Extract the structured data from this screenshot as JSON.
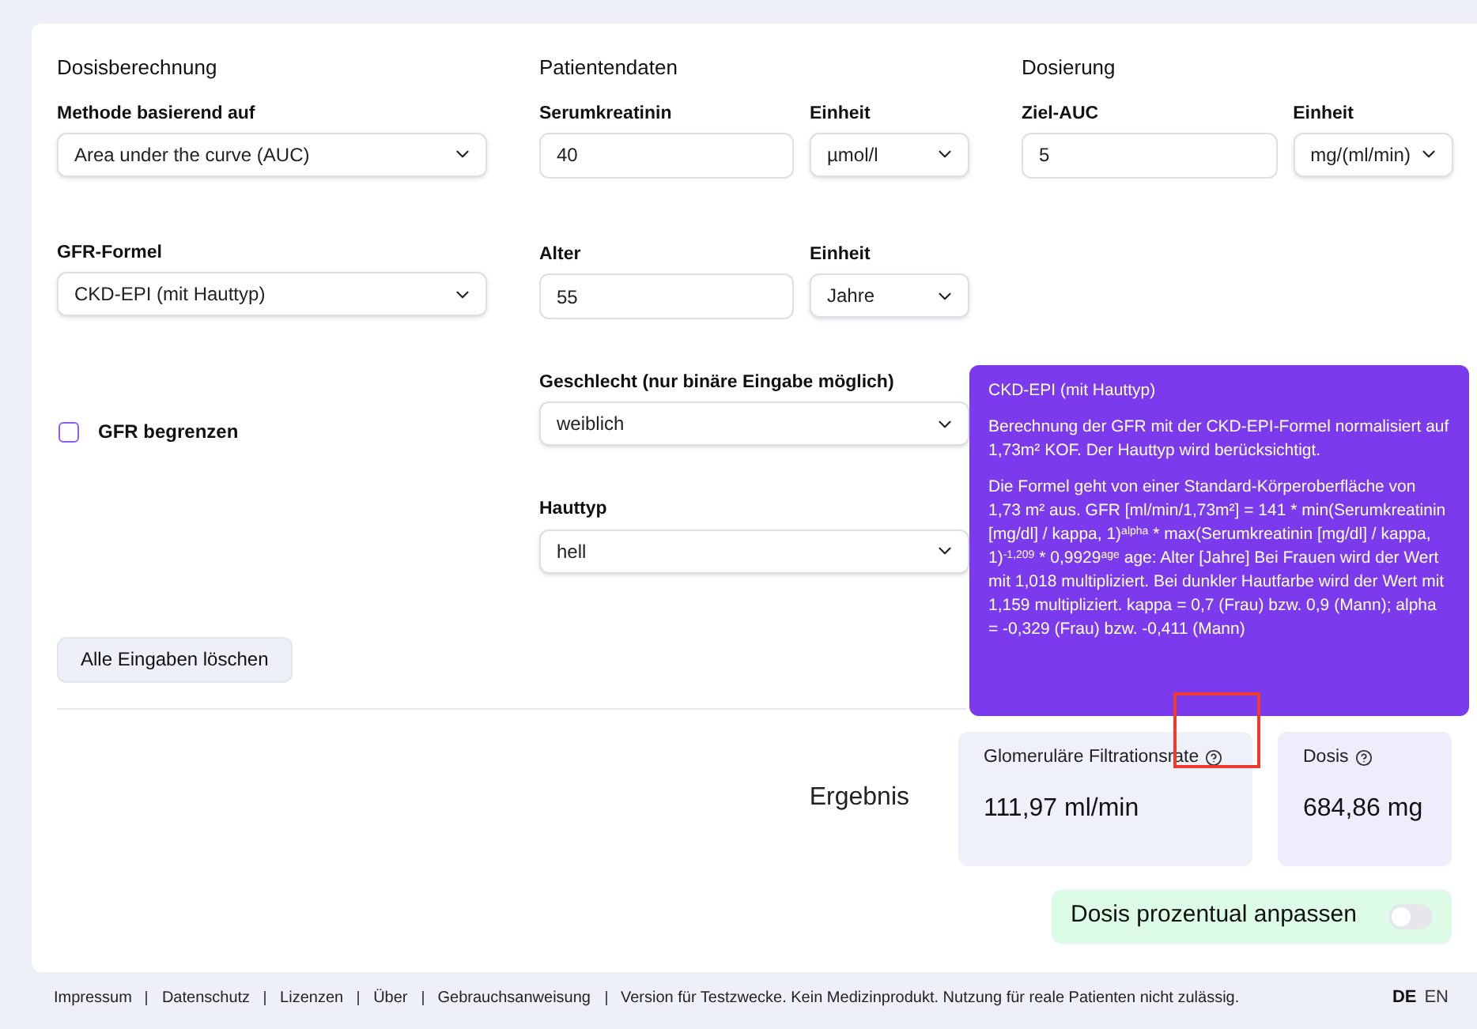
{
  "sections": [
    {
      "heading": "Dosisberechnung",
      "rows": [
        [
          {
            "kind": "select",
            "label": "Methode basierend auf",
            "value": "Area under the curve (AUC)"
          }
        ],
        [
          {
            "kind": "select",
            "label": "GFR-Formel",
            "value": "CKD-EPI (mit Hauttyp)"
          }
        ],
        [
          {
            "kind": "checkbox",
            "label": "GFR begrenzen",
            "checked": false
          }
        ]
      ]
    },
    {
      "heading": "Patientendaten",
      "rows": [
        [
          {
            "kind": "input",
            "label": "Serumkreatinin",
            "value": "40"
          },
          {
            "kind": "select",
            "label": "Einheit",
            "value": "µmol/l"
          }
        ],
        [
          {
            "kind": "input",
            "label": "Alter",
            "value": "55"
          },
          {
            "kind": "select",
            "label": "Einheit",
            "value": "Jahre"
          }
        ],
        [
          {
            "kind": "select",
            "label": "Geschlecht (nur binäre Eingabe möglich)",
            "value": "weiblich"
          }
        ],
        [
          {
            "kind": "select",
            "label": "Hauttyp",
            "value": "hell"
          }
        ]
      ]
    },
    {
      "heading": "Dosierung",
      "rows": [
        [
          {
            "kind": "input",
            "label": "Ziel-AUC",
            "value": "5"
          },
          {
            "kind": "select",
            "label": "Einheit",
            "value": "mg/(ml/min)"
          }
        ]
      ]
    }
  ],
  "clear_button": "Alle Eingaben löschen",
  "tooltip": {
    "title": "CKD-EPI (mit Hauttyp)",
    "paragraphs": [
      "Berechnung der GFR mit der CKD-EPI-Formel normalisiert auf 1,73m² KOF. Der Hauttyp wird berücksichtigt.",
      "Die Formel geht von einer Standard-Körperoberfläche von 1,73 m² aus. GFR [ml/min/1,73m²] = 141 * min(Serumkreatinin [mg/dl] / kappa, 1)$^{alpha}$ * max(Serumkreatinin [mg/dl] / kappa, 1)$^{-1,209}$ * 0,9929$^{age}$ age: Alter [Jahre] Bei Frauen wird der Wert mit 1,018 multipliziert. Bei dunkler Hautfarbe wird der Wert mit 1,159 multipliziert. kappa = 0,7 (Frau) bzw. 0,9 (Mann); alpha = -0,329 (Frau) bzw. -0,411 (Mann)"
    ]
  },
  "result": {
    "label": "Ergebnis",
    "cards": [
      {
        "title": "Glomeruläre Filtrationsrate",
        "value": "111,97 ml/min"
      },
      {
        "title": "Dosis",
        "value": "684,86 mg"
      }
    ]
  },
  "adjust_toggle": {
    "label": "Dosis prozentual anpassen",
    "on": false
  },
  "footer": {
    "links": [
      "Impressum",
      "Datenschutz",
      "Lizenzen",
      "Über",
      "Gebrauchsanweisung"
    ],
    "notice": "Version für Testzwecke. Kein Medizinprodukt. Nutzung für reale Patienten nicht zulässig.",
    "languages": [
      {
        "code": "DE",
        "selected": true
      },
      {
        "code": "EN",
        "selected": false
      }
    ]
  }
}
